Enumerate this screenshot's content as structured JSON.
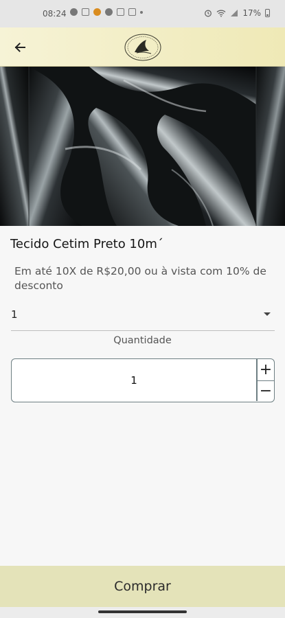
{
  "status_bar": {
    "time": "08:24",
    "battery": "17%"
  },
  "header": {
    "back_icon": "arrow-left-icon",
    "logo_icon": "brand-logo-icon"
  },
  "product": {
    "title": "Tecido Cetim Preto 10m´",
    "price_text": "Em até 10X de R$20,00 ou à vista com 10% de desconto",
    "image": "black-satin-fabric-photo"
  },
  "quantity_select": {
    "value": "1"
  },
  "quantity": {
    "label": "Quantidade",
    "value": "1",
    "plus": "+",
    "minus": "−"
  },
  "actions": {
    "buy_label": "Comprar"
  },
  "colors": {
    "header_bg": "#efe9b6",
    "buy_bar_bg": "#e4e3b9",
    "stepper_border": "#6d7e82"
  }
}
